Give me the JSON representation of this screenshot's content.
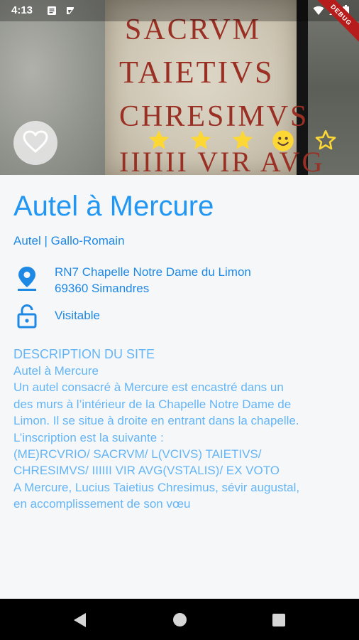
{
  "status_bar": {
    "time": "4:13",
    "notification_icons": [
      "message-icon",
      "inbox-icon"
    ],
    "system_icons": [
      "wifi-icon",
      "signal-icon",
      "battery-icon"
    ]
  },
  "debug_banner": "DEBUG",
  "hero": {
    "image_inscription": [
      "SACRVM",
      "TAIETIVS",
      "CHRESIMVS",
      "IIIIII VIR AVG"
    ],
    "favorite_icon": "heart-outline-icon",
    "rating": {
      "stars_filled": 3,
      "icons": [
        "star-filled-icon",
        "star-filled-icon",
        "star-filled-icon",
        "smiley-icon",
        "star-outline-icon"
      ],
      "color": "#fdd835"
    }
  },
  "site": {
    "title": "Autel à Mercure",
    "subtitle": "Autel | Gallo-Romain",
    "address_line1": "RN7 Chapelle Notre Dame du Limon",
    "address_line2": "69360 Simandres",
    "access": "Visitable"
  },
  "description": {
    "heading": "DESCRIPTION DU SITE",
    "lines": [
      "Autel à Mercure",
      "Un autel consacré à Mercure est encastré dans un",
      "des murs à l’intérieur de la Chapelle Notre Dame de",
      "Limon. Il se situe à droite en entrant dans la chapelle.",
      "L’inscription est la suivante :",
      "(ME)RCVRIO/ SACRVM/ L(VCIVS) TAIETIVS/",
      "CHRESIMVS/ IIIIII VIR AVG(VSTALIS)/ EX VOTO",
      "A Mercure, Lucius Taietius Chresimus, sévir augustal,",
      "en accomplissement de son vœu"
    ]
  },
  "colors": {
    "primary": "#2196f3",
    "secondary_text": "#1e88e5",
    "description_text": "#64b5f6",
    "star": "#fdd835"
  },
  "nav_bar": [
    "back-icon",
    "home-icon",
    "recents-icon"
  ]
}
